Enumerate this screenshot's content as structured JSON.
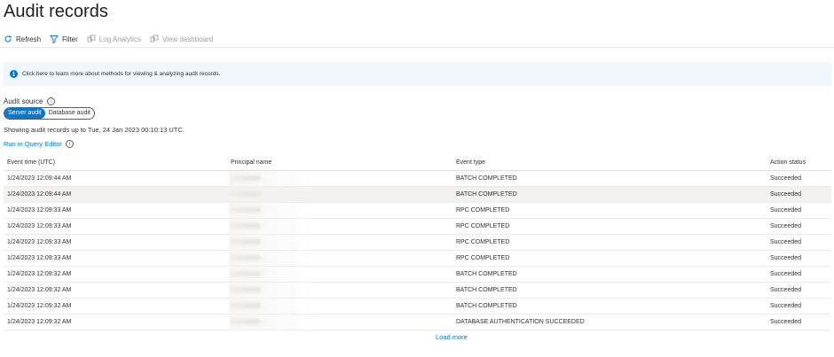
{
  "header": {
    "title": "Audit records",
    "more_label": "···"
  },
  "toolbar": {
    "refresh_label": "Refresh",
    "filter_label": "Filter",
    "log_analytics_label": "Log Analytics",
    "view_dashboard_label": "View dashboard"
  },
  "banner": {
    "text": "Click here to learn more about methods for viewing & analyzing audit records."
  },
  "audit_source": {
    "label": "Audit source",
    "options": [
      "Server audit",
      "Database audit"
    ],
    "selected": "Server audit"
  },
  "showing_text": "Showing audit records up to Tue, 24 Jan 2023 00:10:13 UTC.",
  "query_link": "Run in Query Editor",
  "table": {
    "columns": [
      "Event time (UTC)",
      "Principal name",
      "Event type",
      "Action status"
    ],
    "rows": [
      {
        "time": "1/24/2023 12:09:44 AM",
        "event": "BATCH COMPLETED",
        "status": "Succeeded"
      },
      {
        "time": "1/24/2023 12:09:44 AM",
        "event": "BATCH COMPLETED",
        "status": "Succeeded"
      },
      {
        "time": "1/24/2023 12:09:33 AM",
        "event": "RPC COMPLETED",
        "status": "Succeeded"
      },
      {
        "time": "1/24/2023 12:09:33 AM",
        "event": "RPC COMPLETED",
        "status": "Succeeded"
      },
      {
        "time": "1/24/2023 12:09:33 AM",
        "event": "RPC COMPLETED",
        "status": "Succeeded"
      },
      {
        "time": "1/24/2023 12:09:33 AM",
        "event": "RPC COMPLETED",
        "status": "Succeeded"
      },
      {
        "time": "1/24/2023 12:09:32 AM",
        "event": "BATCH COMPLETED",
        "status": "Succeeded"
      },
      {
        "time": "1/24/2023 12:09:32 AM",
        "event": "BATCH COMPLETED",
        "status": "Succeeded"
      },
      {
        "time": "1/24/2023 12:09:32 AM",
        "event": "BATCH COMPLETED",
        "status": "Succeeded"
      },
      {
        "time": "1/24/2023 12:09:32 AM",
        "event": "DATABASE AUTHENTICATION SUCCEEDED",
        "status": "Succeeded"
      }
    ]
  },
  "load_more": "Load more",
  "colors": {
    "accent": "#0078d4",
    "banner_bg": "#eff6fc",
    "selected_row": "#f3f2f1"
  }
}
